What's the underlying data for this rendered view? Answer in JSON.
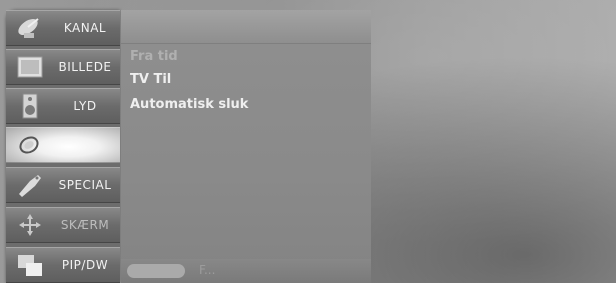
{
  "menu": {
    "items": [
      {
        "label": "KANAL",
        "icon": "satellite-dish-icon"
      },
      {
        "label": "BILLEDE",
        "icon": "picture-icon"
      },
      {
        "label": "LYD",
        "icon": "speaker-icon"
      },
      {
        "label": "",
        "icon": "clock-icon",
        "selected": true
      },
      {
        "label": "SPECIAL",
        "icon": "tag-icon"
      },
      {
        "label": "SKÆRM",
        "icon": "move-arrows-icon"
      },
      {
        "label": "PIP/DW",
        "icon": "pip-windows-icon"
      }
    ]
  },
  "panel": {
    "options": [
      {
        "label": "Fra tid",
        "state": "faded"
      },
      {
        "label": "TV Til",
        "state": "normal"
      },
      {
        "label": "Automatisk  sluk",
        "state": "normal"
      }
    ],
    "footer_text": "F..."
  },
  "colors": {
    "sidebar": "#6d6d6d",
    "active_item": "#ffffff",
    "panel": "#8f8f8f",
    "text": "#efefef"
  }
}
